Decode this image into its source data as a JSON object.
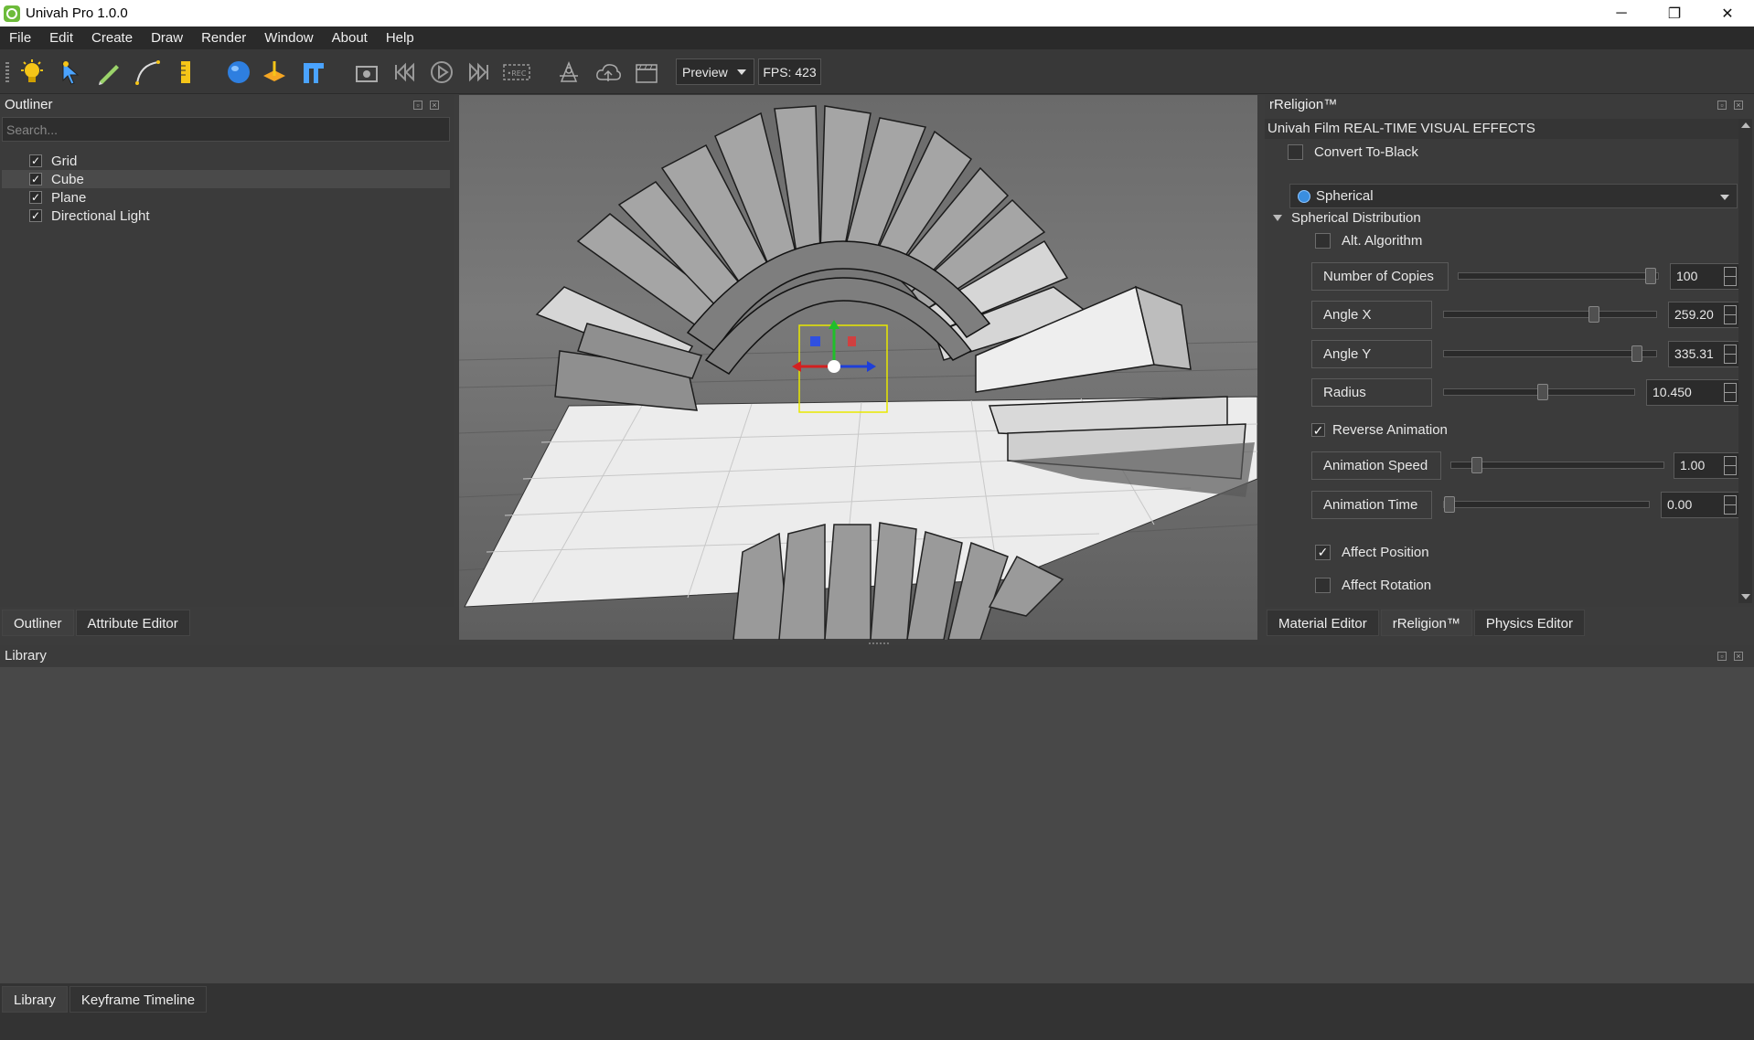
{
  "window": {
    "title": "Univah Pro 1.0.0",
    "minimize": "─",
    "maximize": "❐",
    "close": "✕"
  },
  "menu": [
    "File",
    "Edit",
    "Create",
    "Draw",
    "Render",
    "Window",
    "About",
    "Help"
  ],
  "toolbar": {
    "preview_label": "Preview",
    "fps_label": "FPS: 423"
  },
  "outliner": {
    "title": "Outliner",
    "search_placeholder": "Search...",
    "items": [
      {
        "label": "Grid",
        "checked": true
      },
      {
        "label": "Cube",
        "checked": true,
        "selected": true
      },
      {
        "label": "Plane",
        "checked": true
      },
      {
        "label": "Directional Light",
        "checked": true
      }
    ],
    "tabs": [
      "Outliner",
      "Attribute Editor"
    ]
  },
  "rpanel": {
    "title": "rReligion™",
    "subtitle": "Univah Film REAL-TIME VISUAL EFFECTS",
    "convert_label": "Convert To-Black",
    "mode": "Spherical",
    "section": "Spherical Distribution",
    "alt_label": "Alt. Algorithm",
    "props": [
      {
        "label": "Number of Copies",
        "value": "100",
        "pos": 0.99
      },
      {
        "label": "Angle X",
        "value": "259.20",
        "pos": 0.72
      },
      {
        "label": "Angle Y",
        "value": "335.31",
        "pos": 0.93
      },
      {
        "label": "Radius",
        "value": "10.450",
        "pos": 0.52
      }
    ],
    "reverse_label": "Reverse Animation",
    "anim": [
      {
        "label": "Animation Speed",
        "value": "1.00",
        "pos": 0.1
      },
      {
        "label": "Animation Time",
        "value": "0.00",
        "pos": 0.0
      }
    ],
    "affect_pos_label": "Affect Position",
    "affect_rot_label": "Affect Rotation",
    "tabs": [
      "Material Editor",
      "rReligion™",
      "Physics Editor"
    ]
  },
  "library": {
    "title": "Library",
    "tabs": [
      "Library",
      "Keyframe Timeline"
    ]
  },
  "colors": {
    "accent_blue": "#3a8ee0",
    "panel": "#3b3b3b",
    "viewport_floor": "#e8e8e8"
  }
}
